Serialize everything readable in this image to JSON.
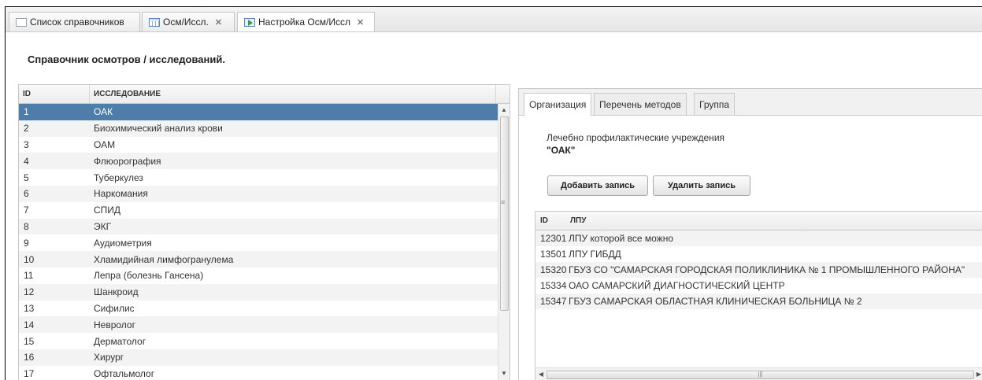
{
  "tabs": [
    {
      "label": "Список справочников",
      "icon": "document-icon",
      "closable": false
    },
    {
      "label": "Осм/Иссл.",
      "icon": "grid-icon",
      "closable": true
    },
    {
      "label": "Настройка Осм/Иссл",
      "icon": "play-icon",
      "closable": true
    }
  ],
  "close_glyph": "✕",
  "page_title": "Справочник осмотров / исследований.",
  "left_grid": {
    "columns": [
      "ID",
      "ИССЛЕДОВАНИЕ"
    ],
    "selected_index": 0,
    "rows": [
      {
        "id": "1",
        "name": "ОАК"
      },
      {
        "id": "2",
        "name": "Биохимический анализ крови"
      },
      {
        "id": "3",
        "name": "ОАМ"
      },
      {
        "id": "4",
        "name": "Флюорография"
      },
      {
        "id": "5",
        "name": "Туберкулез"
      },
      {
        "id": "6",
        "name": "Наркомания"
      },
      {
        "id": "7",
        "name": "СПИД"
      },
      {
        "id": "8",
        "name": "ЭКГ"
      },
      {
        "id": "9",
        "name": "Аудиометрия"
      },
      {
        "id": "10",
        "name": "Хламидийная лимфогранулема"
      },
      {
        "id": "11",
        "name": "Лепра (болезнь Гансена)"
      },
      {
        "id": "12",
        "name": "Шанкроид"
      },
      {
        "id": "13",
        "name": "Сифилис"
      },
      {
        "id": "14",
        "name": "Невролог"
      },
      {
        "id": "15",
        "name": "Дерматолог"
      },
      {
        "id": "16",
        "name": "Хирург"
      },
      {
        "id": "17",
        "name": "Офтальмолог"
      }
    ]
  },
  "right_panel": {
    "tabs": [
      "Организация",
      "Перечень методов",
      "Группа"
    ],
    "active_tab": 0,
    "org_label": "Лечебно профилактические учреждения",
    "selected_name": "\"ОАК\"",
    "add_button": "Добавить запись",
    "delete_button": "Удалить запись",
    "columns": [
      "ID",
      "ЛПУ"
    ],
    "rows": [
      {
        "id": "12301",
        "name": "ЛПУ которой все можно"
      },
      {
        "id": "13501",
        "name": "ЛПУ ГИБДД"
      },
      {
        "id": "15320",
        "name": "ГБУЗ СО \"САМАРСКАЯ ГОРОДСКАЯ ПОЛИКЛИНИКА № 1 ПРОМЫШЛЕННОГО РАЙОНА\""
      },
      {
        "id": "15334",
        "name": "ОАО САМАРСКИЙ ДИАГНОСТИЧЕСКИЙ ЦЕНТР"
      },
      {
        "id": "15347",
        "name": "ГБУЗ САМАРСКАЯ ОБЛАСТНАЯ КЛИНИЧЕСКАЯ БОЛЬНИЦА № 2"
      }
    ]
  },
  "colors": {
    "selection": "#4e7cab"
  }
}
